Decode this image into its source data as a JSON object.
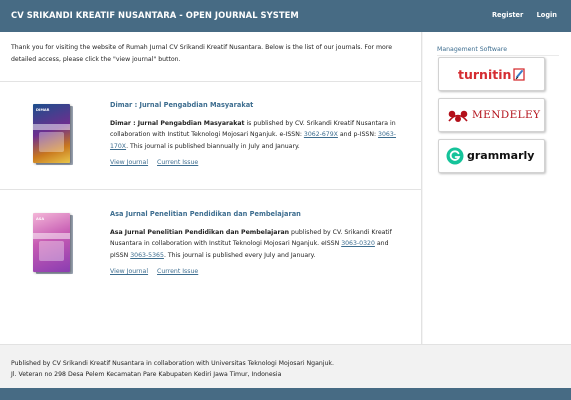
{
  "header": {
    "brand": "CV SRIKANDI KREATIF NUSANTARA - OPEN JOURNAL SYSTEM",
    "register": "Register",
    "login": "Login"
  },
  "intro": {
    "line1": "Thank you for visiting the website of Rumah Jurnal CV Srikandi Kreatif Nusantara. Below is the list of our journals. For more",
    "line2": "detailed access, please click the \"view journal\" button."
  },
  "journals": [
    {
      "title": "Dimar : Jurnal Pengabdian Masyarakat",
      "bold_name": "Dimar : Jurnal Pengabdian Masyarakat",
      "desc_a": " is published by CV. Srikandi Kreatif Nusantara in collaboration with Institut Teknologi Mojosari Nganjuk. e-ISSN: ",
      "eissn": "3062-679X",
      "desc_b": " and p-ISSN: ",
      "pissn": "3063-170X",
      "desc_c": ". This journal is published biannually in July and January.",
      "cover_text": "DIMAR",
      "view": "View Journal",
      "current": "Current Issue"
    },
    {
      "title": "Asa Jurnal Penelitian Pendidikan dan Pembelajaran",
      "bold_name": "Asa Jurnal Penelitian Pendidikan dan Pembelajaran",
      "desc_a": " published by CV. Srikandi Kreatif Nusantara in collaboration with Institut Teknologi Mojosari Nganjuk. eISSN ",
      "eissn": "3063-0320",
      "desc_b": " and pISSN ",
      "pissn": "3063-5365",
      "desc_c": ". This journal is published every July and January.",
      "cover_text": "ASA",
      "view": "View Journal",
      "current": "Current Issue"
    }
  ],
  "sidebar": {
    "title": "Management Software",
    "turnitin": "turnitin",
    "mendeley": "MENDELEY",
    "grammarly": "grammarly"
  },
  "footer": {
    "line1": "Published by CV Srikandi Kreatif Nusantara in collaboration with Universitas Teknologi Mojosari Nganjuk.",
    "line2": "Jl. Veteran no 298 Desa Pelem Kecamatan Pare Kabupaten Kediri Jawa Timur, Indonesia"
  },
  "colors": {
    "header_bg": "#476b84",
    "link": "#3d6d8f",
    "turnitin_red": "#d52d32",
    "mendeley_red": "#b3101a",
    "grammarly_green": "#15c39a"
  }
}
